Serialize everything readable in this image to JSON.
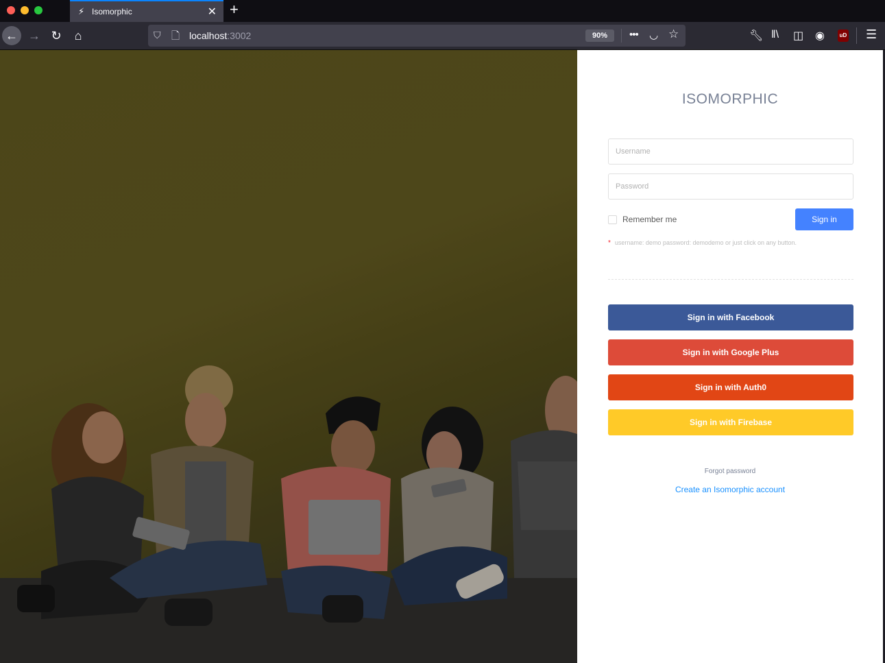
{
  "browser": {
    "tab_title": "Isomorphic",
    "url_host": "localhost",
    "url_port": ":3002",
    "zoom": "90%"
  },
  "icons": {
    "tab_favicon": "bolt-icon",
    "back": "arrow-left-icon",
    "forward": "arrow-right-icon",
    "reload": "reload-icon",
    "home": "home-icon",
    "shield": "shield-icon",
    "page": "page-icon",
    "more": "more-icon",
    "pocket": "pocket-icon",
    "bookmark": "star-icon",
    "wrench": "wrench-icon",
    "library": "library-icon",
    "sidebar": "sidebar-icon",
    "account": "account-icon",
    "ublock": "ublock-icon",
    "menu": "menu-icon",
    "ublock_text": "uD"
  },
  "login": {
    "brand": "ISOMORPHIC",
    "username_placeholder": "Username",
    "password_placeholder": "Password",
    "remember_label": "Remember me",
    "signin_label": "Sign in",
    "hint": "username: demo password: demodemo or just click on any button.",
    "facebook_label": "Sign in with Facebook",
    "google_label": "Sign in with Google Plus",
    "auth0_label": "Sign in with Auth0",
    "firebase_label": "Sign in with Firebase",
    "forgot_label": "Forgot password",
    "create_label": "Create an Isomorphic account"
  },
  "colors": {
    "primary": "#4482ff",
    "facebook": "#3b5998",
    "google_plus": "#dd4b39",
    "auth0": "#e14615",
    "firebase": "#ffca28",
    "link": "#1890ff",
    "brand_text": "#788195"
  }
}
